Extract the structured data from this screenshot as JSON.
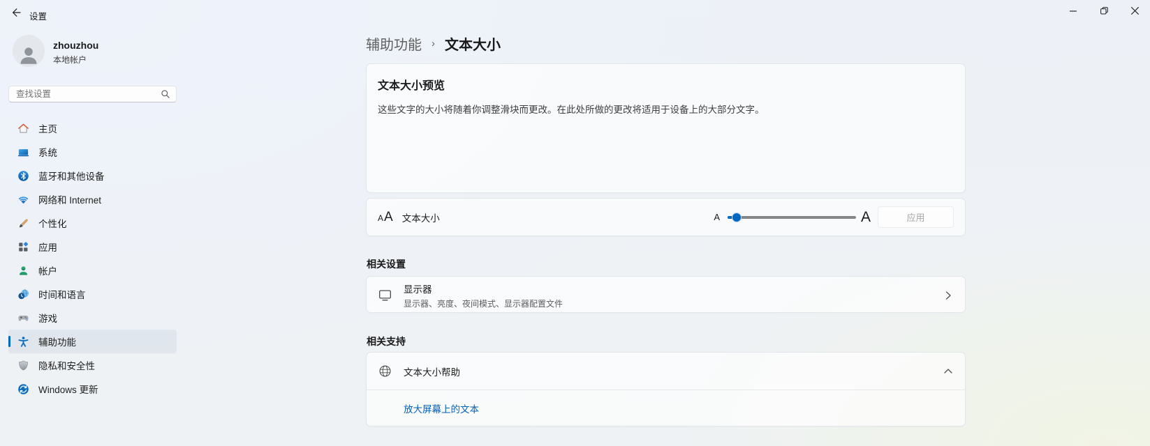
{
  "window": {
    "title": "设置"
  },
  "user": {
    "name": "zhouzhou",
    "account_type": "本地帐户"
  },
  "search": {
    "placeholder": "查找设置"
  },
  "sidebar": {
    "items": [
      {
        "id": "home",
        "label": "主页",
        "icon": "home-icon",
        "selected": false
      },
      {
        "id": "system",
        "label": "系统",
        "icon": "system-icon",
        "selected": false
      },
      {
        "id": "bluetooth",
        "label": "蓝牙和其他设备",
        "icon": "bluetooth-icon",
        "selected": false
      },
      {
        "id": "network",
        "label": "网络和 Internet",
        "icon": "network-icon",
        "selected": false
      },
      {
        "id": "personalization",
        "label": "个性化",
        "icon": "personalization-icon",
        "selected": false
      },
      {
        "id": "apps",
        "label": "应用",
        "icon": "apps-icon",
        "selected": false
      },
      {
        "id": "accounts",
        "label": "帐户",
        "icon": "accounts-icon",
        "selected": false
      },
      {
        "id": "time-language",
        "label": "时间和语言",
        "icon": "time-language-icon",
        "selected": false
      },
      {
        "id": "gaming",
        "label": "游戏",
        "icon": "gaming-icon",
        "selected": false
      },
      {
        "id": "accessibility",
        "label": "辅助功能",
        "icon": "accessibility-icon",
        "selected": true
      },
      {
        "id": "privacy",
        "label": "隐私和安全性",
        "icon": "privacy-icon",
        "selected": false
      },
      {
        "id": "windows-update",
        "label": "Windows 更新",
        "icon": "windows-update-icon",
        "selected": false
      }
    ]
  },
  "breadcrumb": {
    "parent": "辅助功能",
    "separator": "›",
    "current": "文本大小"
  },
  "preview": {
    "title": "文本大小预览",
    "description": "这些文字的大小将随着你调整滑块而更改。在此处所做的更改将适用于设备上的大部分文字。"
  },
  "text_size": {
    "label": "文本大小",
    "icon_small": "A",
    "icon_large": "A",
    "slider_min_label": "A",
    "slider_max_label": "A",
    "slider_percent": 3,
    "apply_label": "应用"
  },
  "related_settings": {
    "header": "相关设置",
    "display": {
      "title": "显示器",
      "subtitle": "显示器、亮度、夜间模式、显示器配置文件"
    }
  },
  "related_support": {
    "header": "相关支持",
    "help": {
      "title": "文本大小帮助"
    },
    "links": [
      {
        "label": "放大屏幕上的文本"
      }
    ]
  },
  "colors": {
    "accent": "#0067c0",
    "link": "#005fb8",
    "selected_indicator": "#0067c0"
  }
}
